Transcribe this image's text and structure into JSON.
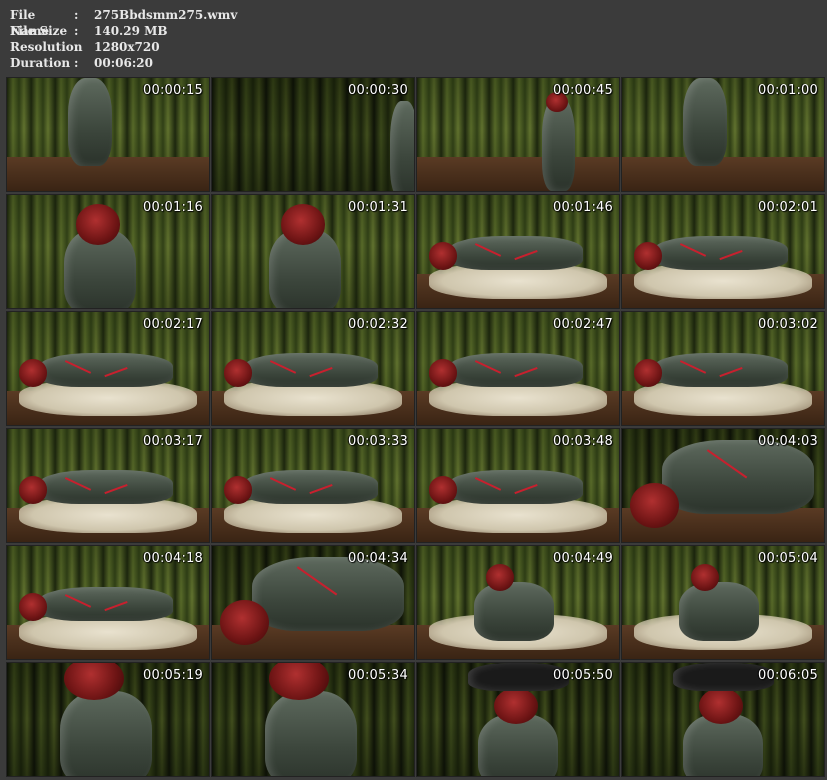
{
  "file_info": {
    "rows": [
      {
        "label": "File Name",
        "sep": ":",
        "value": "275Bbdsmm275.wmv"
      },
      {
        "label": "File Size",
        "sep": ":",
        "value": "140.29 MB"
      },
      {
        "label": "Resolution",
        "sep": ":",
        "value": "1280x720"
      },
      {
        "label": "Duration",
        "sep": ":",
        "value": "00:06:20"
      }
    ]
  },
  "thumbnails": [
    {
      "time": "00:00:15",
      "scene": "standing-legs"
    },
    {
      "time": "00:00:30",
      "scene": "curtain-edge"
    },
    {
      "time": "00:00:45",
      "scene": "standing-small"
    },
    {
      "time": "00:01:00",
      "scene": "standing-legs"
    },
    {
      "time": "00:01:16",
      "scene": "standing-torso"
    },
    {
      "time": "00:01:31",
      "scene": "standing-torso"
    },
    {
      "time": "00:01:46",
      "scene": "lying-rug"
    },
    {
      "time": "00:02:01",
      "scene": "lying-rug"
    },
    {
      "time": "00:02:17",
      "scene": "lying-floor"
    },
    {
      "time": "00:02:32",
      "scene": "lying-floor"
    },
    {
      "time": "00:02:47",
      "scene": "lying-rug"
    },
    {
      "time": "00:03:02",
      "scene": "lying-rug"
    },
    {
      "time": "00:03:17",
      "scene": "lying-floor"
    },
    {
      "time": "00:03:33",
      "scene": "lying-floor"
    },
    {
      "time": "00:03:48",
      "scene": "lying-floor"
    },
    {
      "time": "00:04:03",
      "scene": "lying-closeup"
    },
    {
      "time": "00:04:18",
      "scene": "lying-floor"
    },
    {
      "time": "00:04:34",
      "scene": "lying-closeup"
    },
    {
      "time": "00:04:49",
      "scene": "sitting-rug"
    },
    {
      "time": "00:05:04",
      "scene": "sitting-rug"
    },
    {
      "time": "00:05:19",
      "scene": "standing-closeup"
    },
    {
      "time": "00:05:34",
      "scene": "standing-closeup"
    },
    {
      "time": "00:05:50",
      "scene": "standing-pair"
    },
    {
      "time": "00:06:05",
      "scene": "standing-pair"
    }
  ],
  "colors": {
    "background": "#3b3b3b",
    "text": "#e8e8e8",
    "timestamp": "#ffffff",
    "rope": "#c8202e"
  }
}
